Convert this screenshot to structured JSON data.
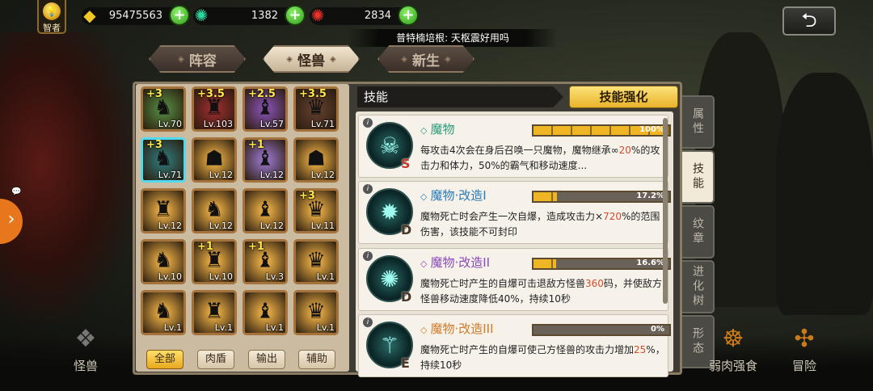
{
  "topbar": {
    "rank_label": "智者",
    "resources": [
      {
        "icon": "gold-gem-icon",
        "value": "95475563"
      },
      {
        "icon": "green-crystal-icon",
        "value": "1382"
      },
      {
        "icon": "red-crystal-icon",
        "value": "2834"
      }
    ],
    "ticker_text": "普特楠培根: 天枢震好用吗"
  },
  "tabs": [
    {
      "label": "阵容"
    },
    {
      "label": "怪兽"
    },
    {
      "label": "新生"
    }
  ],
  "inventory": {
    "slots": [
      {
        "plus": "+3",
        "level": "Lv.70",
        "color": "#4f7a3a"
      },
      {
        "plus": "+3.5",
        "level": "Lv.103",
        "color": "#8a2a2a"
      },
      {
        "plus": "+2.5",
        "level": "Lv.57",
        "color": "#7a4a9a"
      },
      {
        "plus": "+3.5",
        "level": "Lv.71",
        "color": "#5a3a2a"
      },
      {
        "plus": "+3",
        "level": "Lv.71",
        "color": "#2f6b6a"
      },
      {
        "plus": "",
        "level": "Lv.12",
        "color": "#d8a040"
      },
      {
        "plus": "+1",
        "level": "Lv.12",
        "color": "#8a6ab0"
      },
      {
        "plus": "",
        "level": "Lv.12",
        "color": "#d8a040"
      },
      {
        "plus": "",
        "level": "Lv.12",
        "color": "#d8a040"
      },
      {
        "plus": "",
        "level": "Lv.12",
        "color": "#d8a040"
      },
      {
        "plus": "",
        "level": "Lv.12",
        "color": "#d8a040"
      },
      {
        "plus": "+3",
        "level": "Lv.11",
        "color": "#d8a040"
      },
      {
        "plus": "",
        "level": "Lv.10",
        "color": "#d8a040"
      },
      {
        "plus": "+1",
        "level": "Lv.10",
        "color": "#d8a040"
      },
      {
        "plus": "+1",
        "level": "Lv.3",
        "color": "#d8a040"
      },
      {
        "plus": "",
        "level": "Lv.1",
        "color": "#d8a040"
      },
      {
        "plus": "",
        "level": "Lv.1",
        "color": "#d8a040"
      },
      {
        "plus": "",
        "level": "Lv.1",
        "color": "#d8a040"
      },
      {
        "plus": "",
        "level": "Lv.1",
        "color": "#d8a040"
      },
      {
        "plus": "",
        "level": "Lv.1",
        "color": "#d8a040"
      }
    ],
    "filters": [
      {
        "label": "全部"
      },
      {
        "label": "肉盾"
      },
      {
        "label": "输出"
      },
      {
        "label": "辅助"
      }
    ]
  },
  "skills_panel": {
    "header": "技能",
    "enhance_button": "技能强化",
    "skills": [
      {
        "name": "魔物",
        "grade": "S",
        "progress_percent": 100,
        "progress_label": "100%",
        "desc_parts": [
          "每攻击4次会在身后召唤一只魔物，魔物继承∞",
          "20",
          "%的攻击力和体力，50%的霸气和移动速度..."
        ]
      },
      {
        "name": "魔物·改造I",
        "grade": "D",
        "progress_percent": 17.2,
        "progress_label": "17.2%",
        "desc_parts": [
          "魔物死亡时会产生一次自爆，造成攻击力×",
          "720",
          "%的范围伤害，该技能不可封印"
        ]
      },
      {
        "name": "魔物·改造II",
        "grade": "D",
        "progress_percent": 16.6,
        "progress_label": "16.6%",
        "desc_parts": [
          "魔物死亡时产生的自爆可击退敌方怪兽",
          "360",
          "码，并使敌方怪兽移动速度降低40%，持续10秒"
        ]
      },
      {
        "name": "魔物·改造III",
        "grade": "E",
        "progress_percent": 0,
        "progress_label": "0%",
        "desc_parts": [
          "魔物死亡时产生的自爆可使己方怪兽的攻击力增加",
          "25",
          "%，持续10秒"
        ]
      }
    ]
  },
  "side_tabs": [
    {
      "label": "属性"
    },
    {
      "label": "技能"
    },
    {
      "label": "纹章"
    },
    {
      "label": "进化树"
    },
    {
      "label": "形态"
    }
  ],
  "bottom_nav": [
    {
      "label": "怪兽"
    },
    {
      "label": "弱肉强食"
    },
    {
      "label": "冒险"
    }
  ],
  "colors": {
    "accent": "#e8b32a",
    "highlight_red": "#d64a2a",
    "skill_name": "#2a9a7a"
  }
}
